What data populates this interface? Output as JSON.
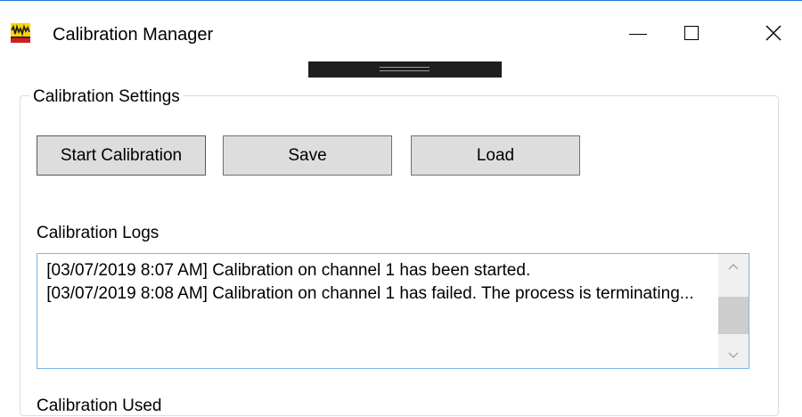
{
  "window": {
    "title": "Calibration Manager",
    "icons": {
      "app": "waveform-app-icon",
      "minimize": "minimize-icon",
      "maximize": "maximize-icon",
      "close": "close-icon",
      "grip": "drag-grip-icon",
      "scroll_up": "chevron-up-icon",
      "scroll_down": "chevron-down-icon"
    },
    "colors": {
      "accent": "#1f7ad6",
      "button_bg": "#dddddd",
      "log_border": "#7eb4ea"
    }
  },
  "settings": {
    "group_title": "Calibration Settings",
    "buttons": {
      "start": "Start Calibration",
      "save": "Save",
      "load": "Load"
    },
    "logs": {
      "label": "Calibration Logs",
      "text": " [03/07/2019 8:07 AM] Calibration on channel 1 has been started.\n [03/07/2019 8:08 AM] Calibration on channel 1 has failed. The process is terminating..."
    },
    "next_section_label": "Calibration Used"
  }
}
